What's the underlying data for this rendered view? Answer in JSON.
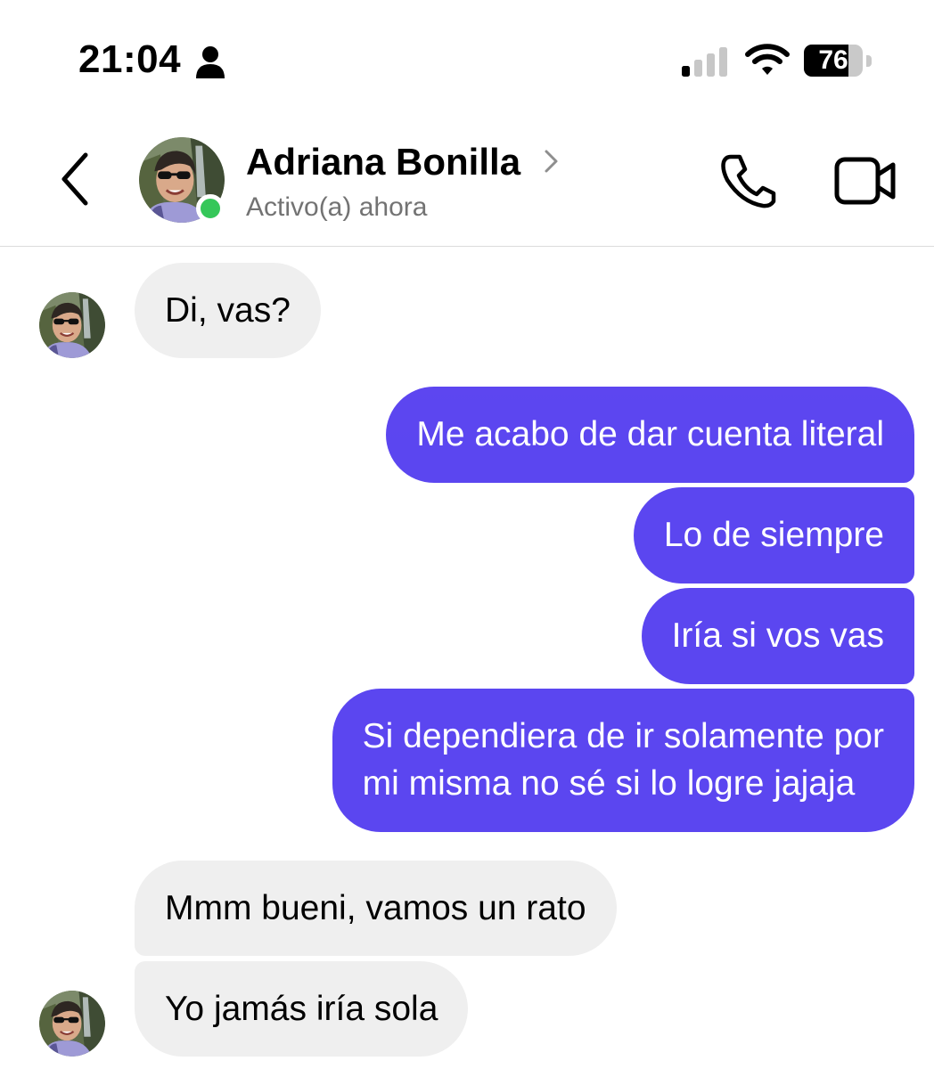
{
  "status_bar": {
    "time": "21:04",
    "battery_level": "76",
    "battery_fraction": 0.76,
    "signal_bars_active": 1,
    "signal_bars_total": 4,
    "icons": [
      "person-icon",
      "signal-icon",
      "wifi-icon",
      "battery-icon"
    ]
  },
  "header": {
    "contact_name": "Adriana Bonilla",
    "status": "Activo(a) ahora",
    "icons": [
      "back-arrow-icon",
      "chevron-right-icon",
      "phone-icon",
      "video-camera-icon"
    ]
  },
  "colors": {
    "outgoing_top": "#6a44ec",
    "outgoing_bottom": "#5b46f0",
    "incoming": "#efefef",
    "online": "#35c759",
    "status_text": "#737373"
  },
  "messages": [
    {
      "direction": "in",
      "text": "Di, vas?"
    },
    {
      "direction": "out",
      "text": "Me acabo de dar cuenta literal"
    },
    {
      "direction": "out",
      "text": "Lo de siempre"
    },
    {
      "direction": "out",
      "text": "Iría si vos vas"
    },
    {
      "direction": "out",
      "lines": [
        "Si dependiera de ir solamente por",
        "mi misma no sé si lo logre jajaja"
      ]
    },
    {
      "direction": "in",
      "text": "Mmm bueni, vamos un rato"
    },
    {
      "direction": "in",
      "text": "Yo jamás iría sola"
    }
  ]
}
